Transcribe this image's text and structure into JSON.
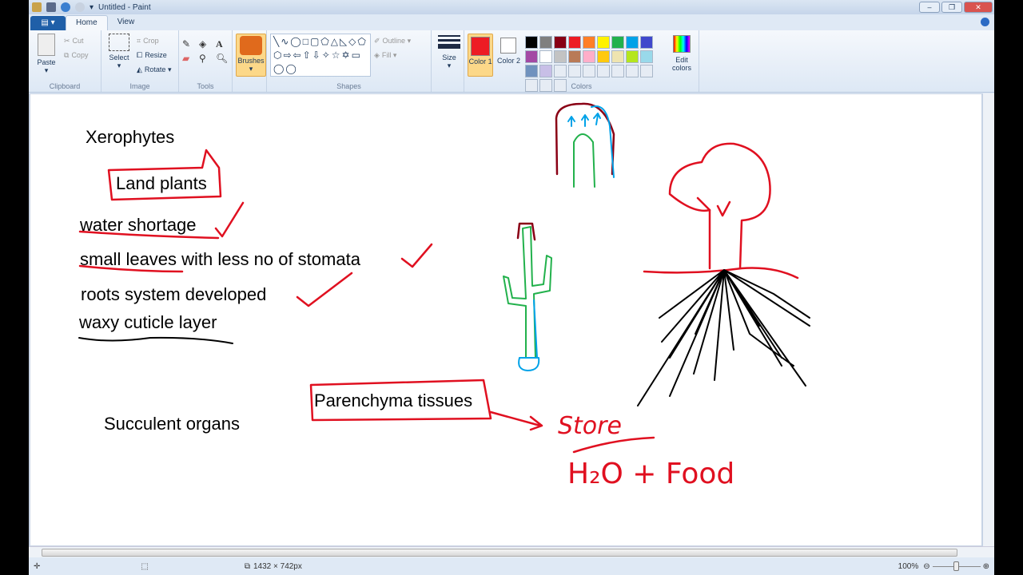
{
  "title": "Untitled - Paint",
  "tabs": {
    "file": "▤ ▾",
    "home": "Home",
    "view": "View"
  },
  "clipboard": {
    "paste": "Paste",
    "cut": "Cut",
    "copy": "Copy",
    "label": "Clipboard"
  },
  "image": {
    "select": "Select",
    "crop": "Crop",
    "resize": "Resize",
    "rotate": "Rotate ▾",
    "label": "Image"
  },
  "tools": {
    "label": "Tools"
  },
  "brushes": {
    "label": "Brushes"
  },
  "shapes": {
    "outline": "Outline ▾",
    "fill": "Fill ▾",
    "label": "Shapes",
    "glyphs": "╲∿◯□▢⬠△◺◇⬠⬡⇨⇦⇧⇩✧☆✡▭◯◯"
  },
  "size": {
    "label": "Size"
  },
  "colors": {
    "color1": "Color 1",
    "color2": "Color 2",
    "edit": "Edit colors",
    "label": "Colors",
    "color1_value": "#ed1c24",
    "color2_value": "#ffffff",
    "palette": [
      "#000000",
      "#7f7f7f",
      "#880015",
      "#ed1c24",
      "#ff7f27",
      "#fff200",
      "#22b14c",
      "#00a2e8",
      "#3f48cc",
      "#a349a4",
      "#ffffff",
      "#c3c3c3",
      "#b97a57",
      "#ffaec9",
      "#ffc90e",
      "#efe4b0",
      "#b5e61d",
      "#99d9ea",
      "#7092be",
      "#c8bfe7"
    ]
  },
  "canvas": {
    "xerophytes": "Xerophytes",
    "land_plants": "Land plants",
    "water_shortage": "water shortage",
    "small_leaves": "small leaves with less no of stomata",
    "roots": "roots system developed",
    "waxy": "waxy cuticle layer",
    "succulent": "Succulent organs",
    "parenchyma": "Parenchyma tissues",
    "store": "Store",
    "h2o_food": "H₂O + Food"
  },
  "status": {
    "dimensions": "1432 × 742px",
    "zoom": "100%"
  }
}
